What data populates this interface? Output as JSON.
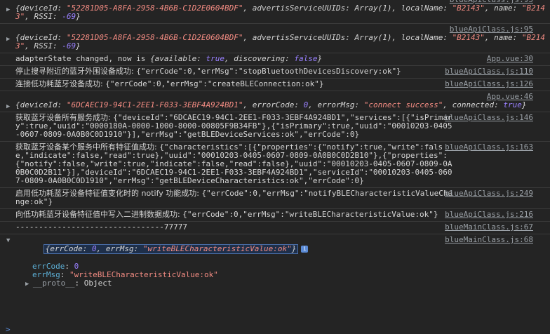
{
  "logs": [
    {
      "src": "blueApiClass.js:95",
      "parts": [
        {
          "t": "{",
          "c": "it"
        },
        {
          "t": "deviceId: ",
          "c": "key"
        },
        {
          "t": "\"52281D05-A8FA-2958-4B6B-C1D2E0604BDF\"",
          "c": "str"
        },
        {
          "t": ", advertisServiceUUIDs: ",
          "c": "key"
        },
        {
          "t": "Array(1)",
          "c": "it"
        },
        {
          "t": ", localName: ",
          "c": "key"
        },
        {
          "t": "\"B2143\"",
          "c": "str"
        },
        {
          "t": ", name: ",
          "c": "key"
        },
        {
          "t": "\"B2143\"",
          "c": "str"
        },
        {
          "t": ", RSSI: ",
          "c": "key"
        },
        {
          "t": "-69",
          "c": "num"
        },
        {
          "t": "}",
          "c": "it"
        }
      ]
    },
    {
      "src": "blueApiClass.js:95",
      "parts": [
        {
          "t": "{",
          "c": "it"
        },
        {
          "t": "deviceId: ",
          "c": "key"
        },
        {
          "t": "\"52281D05-A8FA-2958-4B6B-C1D2E0604BDF\"",
          "c": "str"
        },
        {
          "t": ", advertisServiceUUIDs: ",
          "c": "key"
        },
        {
          "t": "Array(1)",
          "c": "it"
        },
        {
          "t": ", localName: ",
          "c": "key"
        },
        {
          "t": "\"B2143\"",
          "c": "str"
        },
        {
          "t": ", name: ",
          "c": "key"
        },
        {
          "t": "\"B2143\"",
          "c": "str"
        },
        {
          "t": ", RSSI: ",
          "c": "key"
        },
        {
          "t": "-69",
          "c": "num"
        },
        {
          "t": "}",
          "c": "it"
        }
      ]
    },
    {
      "src": "App.vue:30",
      "parts": [
        {
          "t": "adapterState changed, now is ",
          "c": ""
        },
        {
          "t": "{available: ",
          "c": "key"
        },
        {
          "t": "true",
          "c": "kw"
        },
        {
          "t": ", discovering: ",
          "c": "key"
        },
        {
          "t": "false",
          "c": "kw"
        },
        {
          "t": "}",
          "c": "it"
        }
      ]
    },
    {
      "src": "blueApiClass.js:110",
      "parts": [
        {
          "t": "停止搜寻附近的蓝牙外围设备成功: ",
          "c": "cjk"
        },
        {
          "t": "{\"errCode\":0,\"errMsg\":\"stopBluetoothDevicesDiscovery:ok\"}",
          "c": ""
        }
      ]
    },
    {
      "src": "blueApiClass.js:126",
      "parts": [
        {
          "t": "连接低功耗蓝牙设备成功: ",
          "c": "cjk"
        },
        {
          "t": "{\"errCode\":0,\"errMsg\":\"createBLEConnection:ok\"}",
          "c": ""
        }
      ]
    },
    {
      "src": "App.vue:46",
      "parts": [
        {
          "t": "{",
          "c": "it"
        },
        {
          "t": "deviceId: ",
          "c": "key"
        },
        {
          "t": "\"6DCAEC19-94C1-2EE1-F033-3EBF4A924BD1\"",
          "c": "str"
        },
        {
          "t": ", errorCode: ",
          "c": "key"
        },
        {
          "t": "0",
          "c": "num"
        },
        {
          "t": ", errorMsg: ",
          "c": "key"
        },
        {
          "t": "\"connect success\"",
          "c": "str"
        },
        {
          "t": ", connected: ",
          "c": "key"
        },
        {
          "t": "true",
          "c": "kw"
        },
        {
          "t": "}",
          "c": "it"
        }
      ]
    },
    {
      "src": "blueApiClass.js:146",
      "parts": [
        {
          "t": "获取蓝牙设备所有服务成功: ",
          "c": "cjk"
        },
        {
          "t": "{\"deviceId\":\"6DCAEC19-94C1-2EE1-F033-3EBF4A924BD1\",\"services\":[{\"isPrimary\":true,\"uuid\":\"0000180A-0000-1000-8000-00805F9B34FB\"},{\"isPrimary\":true,\"uuid\":\"00010203-0405-0607-0809-0A0B0C0D1910\"}],\"errMsg\":\"getBLEDeviceServices:ok\",\"errCode\":0}",
          "c": ""
        }
      ]
    },
    {
      "src": "blueApiClass.js:163",
      "parts": [
        {
          "t": "获取蓝牙设备某个服务中所有特征值成功: ",
          "c": "cjk"
        },
        {
          "t": "{\"characteristics\":[{\"properties\":{\"notify\":true,\"write\":false,\"indicate\":false,\"read\":true},\"uuid\":\"00010203-0405-0607-0809-0A0B0C0D2B10\"},{\"properties\":{\"notify\":false,\"write\":true,\"indicate\":false,\"read\":false},\"uuid\":\"00010203-0405-0607-0809-0A0B0C0D2B11\"}],\"deviceId\":\"6DCAEC19-94C1-2EE1-F033-3EBF4A924BD1\",\"serviceId\":\"00010203-0405-0607-0809-0A0B0C0D1910\",\"errMsg\":\"getBLEDeviceCharacteristics:ok\",\"errCode\":0}",
          "c": ""
        }
      ]
    },
    {
      "src": "blueApiClass.js:249",
      "parts": [
        {
          "t": "启用低功耗蓝牙设备特征值变化时的 notify 功能成功: ",
          "c": "cjk"
        },
        {
          "t": "{\"errCode\":0,\"errMsg\":\"notifyBLECharacteristicValueChange:ok\"}",
          "c": ""
        }
      ]
    },
    {
      "src": "blueApiClass.js:216",
      "parts": [
        {
          "t": "向低功耗蓝牙设备特征值中写入二进制数据成功: ",
          "c": "cjk"
        },
        {
          "t": "{\"errCode\":0,\"errMsg\":\"writeBLECharacteristicValue:ok\"}",
          "c": ""
        }
      ]
    },
    {
      "src": "blueMainClass.js:67",
      "parts": [
        {
          "t": "--------------------------------77777",
          "c": ""
        }
      ]
    }
  ],
  "expanded": {
    "src": "blueMainClass.js:68",
    "summary_open": "{",
    "k1": "errCode: ",
    "v1": "0",
    "k2": ", errMsg: ",
    "v2": "\"writeBLECharacteristicValue:ok\"",
    "summary_close": "}",
    "badge": "i",
    "prop1_key": "errCode",
    "prop1_val": "0",
    "prop2_key": "errMsg",
    "prop2_val": "\"writeBLECharacteristicValue:ok\"",
    "proto_key": "__proto__",
    "proto_val": "Object"
  },
  "prompt": ">"
}
